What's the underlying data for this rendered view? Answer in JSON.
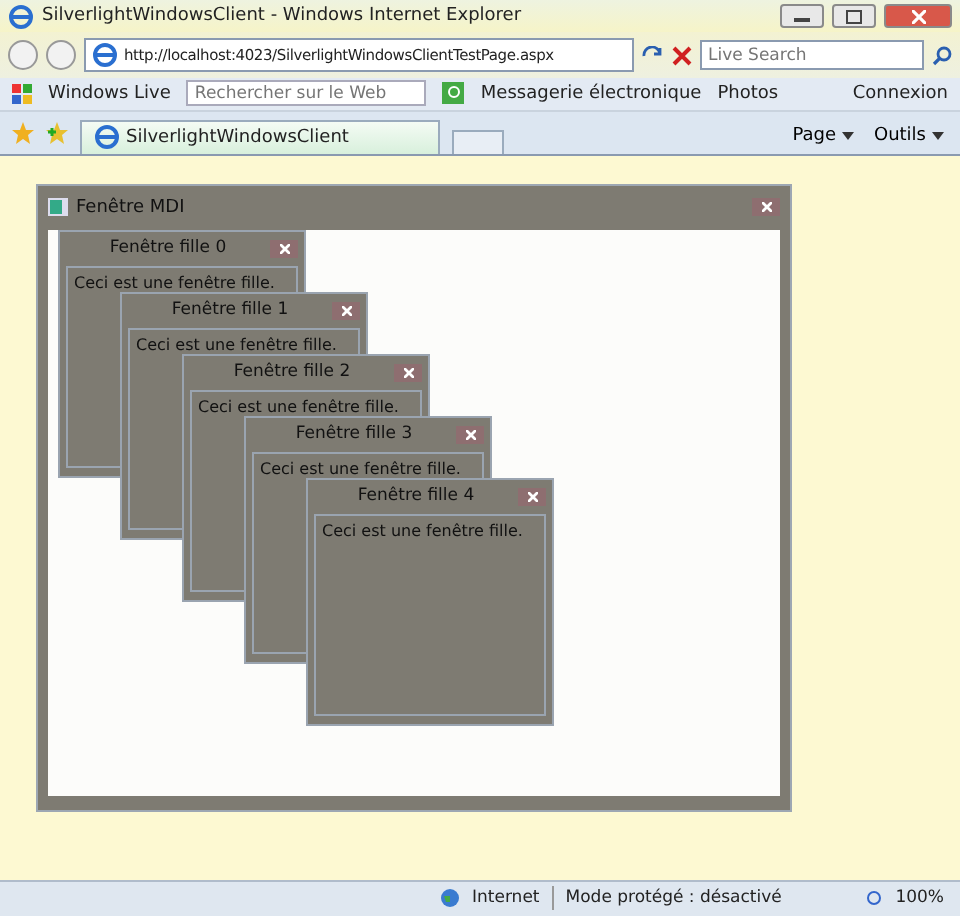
{
  "window": {
    "title": "SilverlightWindowsClient - Windows Internet Explorer"
  },
  "address_bar": {
    "url": "http://localhost:4023/SilverlightWindowsClientTestPage.aspx",
    "search_placeholder": "Live Search"
  },
  "links_bar": {
    "brand": "Windows Live",
    "search_placeholder": "Rechercher sur le Web",
    "links": [
      "Messagerie électronique",
      "Photos"
    ],
    "signin": "Connexion"
  },
  "tab_bar": {
    "tabs": [
      {
        "label": "SilverlightWindowsClient",
        "selected": true
      }
    ],
    "menus": [
      "Page",
      "Outils"
    ]
  },
  "mdi_window": {
    "title": "Fenêtre MDI",
    "children": [
      {
        "title": "Fenêtre fille 0",
        "text": "Ceci est une fenêtre fille."
      },
      {
        "title": "Fenêtre fille 1",
        "text": "Ceci est une fenêtre fille."
      },
      {
        "title": "Fenêtre fille 2",
        "text": "Ceci est une fenêtre fille."
      },
      {
        "title": "Fenêtre fille 3",
        "text": "Ceci est une fenêtre fille."
      },
      {
        "title": "Fenêtre fille 4",
        "text": "Ceci est une fenêtre fille."
      }
    ]
  },
  "status_bar": {
    "zone": "Internet",
    "mode": "Mode protégé : désactivé",
    "zoom": "100%"
  }
}
